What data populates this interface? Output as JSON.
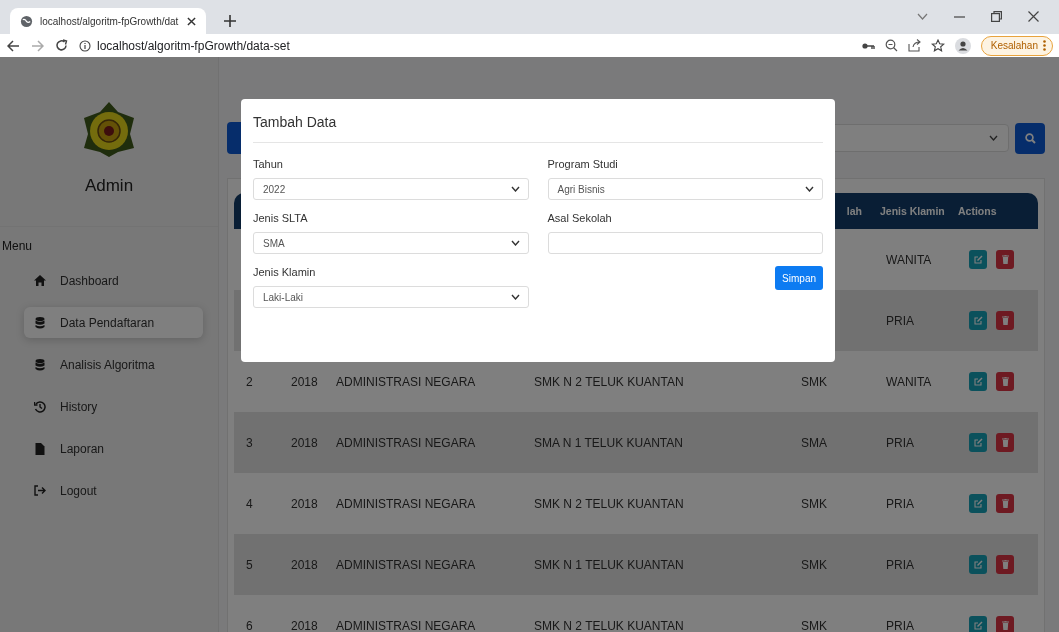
{
  "browser": {
    "tab_title": "localhost/algoritm-fpGrowth/dat",
    "url": "localhost/algoritm-fpGrowth/data-set",
    "profile_button": "Kesalahan"
  },
  "sidebar": {
    "user": "Admin",
    "menu_heading": "Menu",
    "items": [
      {
        "label": "Dashboard",
        "kind": "home",
        "selected": false
      },
      {
        "label": "Data Pendaftaran",
        "kind": "database",
        "selected": true
      },
      {
        "label": "Analisis Algoritma",
        "kind": "database",
        "selected": false
      },
      {
        "label": "History",
        "kind": "history",
        "selected": false
      },
      {
        "label": "Laporan",
        "kind": "file",
        "selected": false
      },
      {
        "label": "Logout",
        "kind": "logout",
        "selected": false
      }
    ]
  },
  "table": {
    "columns": [
      "lah",
      "Jenis Klamin",
      "Actions"
    ],
    "rows": [
      {
        "klamin": "WANITA"
      },
      {
        "klamin": "PRIA"
      },
      {
        "no": "2",
        "year": "2018",
        "prodi": "ADMINISTRASI NEGARA",
        "school": "SMK N 2 TELUK KUANTAN",
        "slta": "SMK",
        "klamin": "WANITA"
      },
      {
        "no": "3",
        "year": "2018",
        "prodi": "ADMINISTRASI NEGARA",
        "school": "SMA N 1 TELUK KUANTAN",
        "slta": "SMA",
        "klamin": "PRIA"
      },
      {
        "no": "4",
        "year": "2018",
        "prodi": "ADMINISTRASI NEGARA",
        "school": "SMK N 2 TELUK KUANTAN",
        "slta": "SMK",
        "klamin": "PRIA"
      },
      {
        "no": "5",
        "year": "2018",
        "prodi": "ADMINISTRASI NEGARA",
        "school": "SMK N 1 TELUK KUANTAN",
        "slta": "SMK",
        "klamin": "PRIA"
      },
      {
        "no": "6",
        "year": "2018",
        "prodi": "ADMINISTRASI NEGARA",
        "school": "SMK N 2 TELUK KUANTAN",
        "slta": "SMK",
        "klamin": "PRIA"
      }
    ]
  },
  "modal": {
    "title": "Tambah Data",
    "fields": [
      {
        "label": "Tahun",
        "kind": "select",
        "value": "2022"
      },
      {
        "label": "Program Studi",
        "kind": "select",
        "value": "Agri Bisnis"
      },
      {
        "label": "Jenis SLTA",
        "kind": "select",
        "value": "SMA"
      },
      {
        "label": "Asal Sekolah",
        "kind": "text"
      },
      {
        "label": "Jenis Klamin",
        "kind": "select",
        "value": "Laki-Laki"
      }
    ],
    "submit": "Simpan"
  }
}
